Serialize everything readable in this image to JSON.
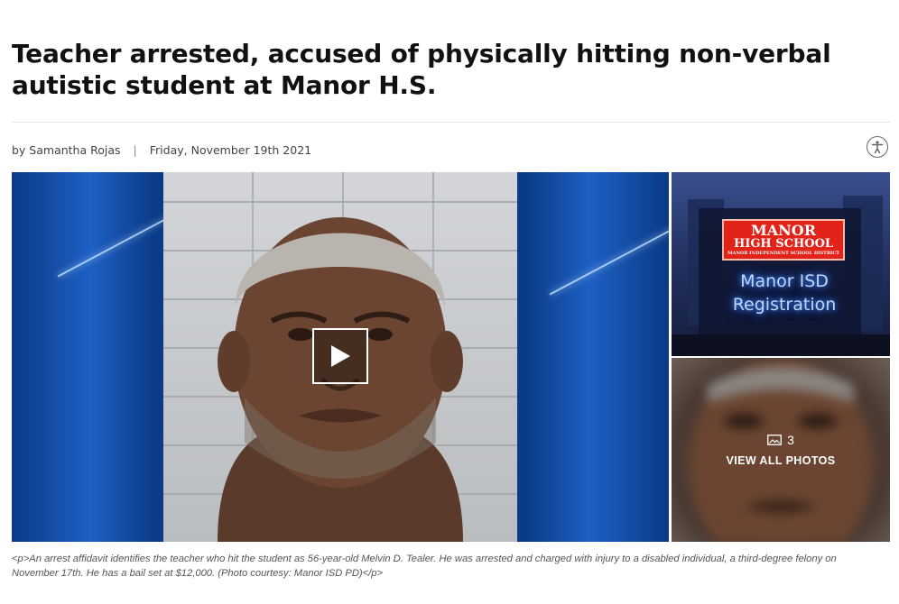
{
  "article": {
    "headline": "Teacher arrested, accused of physically hitting non-verbal autistic student at Manor H.S.",
    "author": "by Samantha Rojas",
    "separator": "|",
    "date": "Friday, November 19th 2021"
  },
  "icons": {
    "accessibility": "accessibility-icon",
    "play": "play-icon",
    "photos": "image-icon"
  },
  "gallery": {
    "school_sign": {
      "line1": "MANOR",
      "line2": "HIGH SCHOOL",
      "line3": "MANOR INDEPENDENT SCHOOL DISTRICT",
      "led_line1": "Manor ISD",
      "led_line2": "Registration"
    },
    "photo_count": "3",
    "view_all_label": "VIEW ALL PHOTOS"
  },
  "caption": "<p>An arrest affidavit identifies the teacher who hit the student as 56-year-old Melvin D. Tealer. He was arrested and charged with injury to a disabled individual, a third-degree felony on November 17th. He has a bail set at $12,000. (Photo courtesy: Manor ISD PD)</p>",
  "colors": {
    "hero_background": "#0b3a86",
    "sign_red": "#e2231a",
    "led_blue": "#b8d8ff"
  }
}
